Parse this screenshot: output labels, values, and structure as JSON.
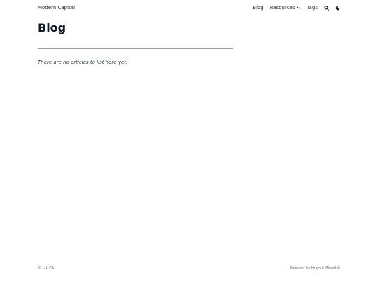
{
  "header": {
    "site_title": "Modern Capital",
    "nav": {
      "blog": "Blog",
      "resources": "Resources",
      "tags": "Tags"
    },
    "icons": {
      "resources_dropdown": "chevron-down-icon",
      "search": "search-icon",
      "theme_toggle": "moon-icon"
    }
  },
  "main": {
    "title": "Blog",
    "empty_message": "There are no articles to list here yet."
  },
  "footer": {
    "copyright": "© 2024",
    "powered_by": "Powered by Hugo & Blowfish"
  }
}
